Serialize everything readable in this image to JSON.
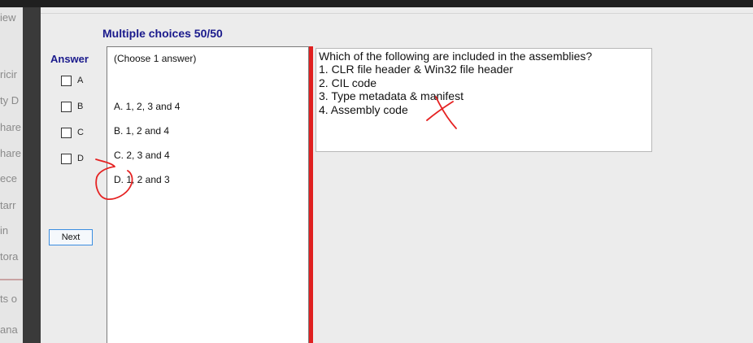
{
  "background": {
    "sidebar_fragments": [
      "iew",
      "ricir",
      "ty D",
      "hare",
      "hare",
      "ece",
      "tarr",
      "in",
      "tora",
      "ts o",
      "ana"
    ]
  },
  "header": {
    "title": "Multiple choices 50/50"
  },
  "answer": {
    "title": "Answer",
    "checkboxes": [
      {
        "letter": "A",
        "checked": false
      },
      {
        "letter": "B",
        "checked": false
      },
      {
        "letter": "C",
        "checked": false
      },
      {
        "letter": "D",
        "checked": false
      }
    ]
  },
  "next_button": {
    "label": "Next"
  },
  "choices": {
    "hint": "(Choose 1 answer)",
    "options": [
      "A.  1, 2, 3 and 4",
      "B.  1, 2 and 4",
      "C.  2, 3 and 4",
      "D.  1, 2 and 3"
    ]
  },
  "question": {
    "lines": [
      "Which of the following are included in the assemblies?",
      "1. CLR file header & Win32 file header",
      "2. CIL code",
      "3. Type metadata & manifest",
      "4. Assembly code"
    ]
  },
  "colors": {
    "title_blue": "#1a1a8c",
    "splitter_red": "#e02020",
    "annotation_red": "#e52222",
    "button_border": "#3a8de0"
  }
}
